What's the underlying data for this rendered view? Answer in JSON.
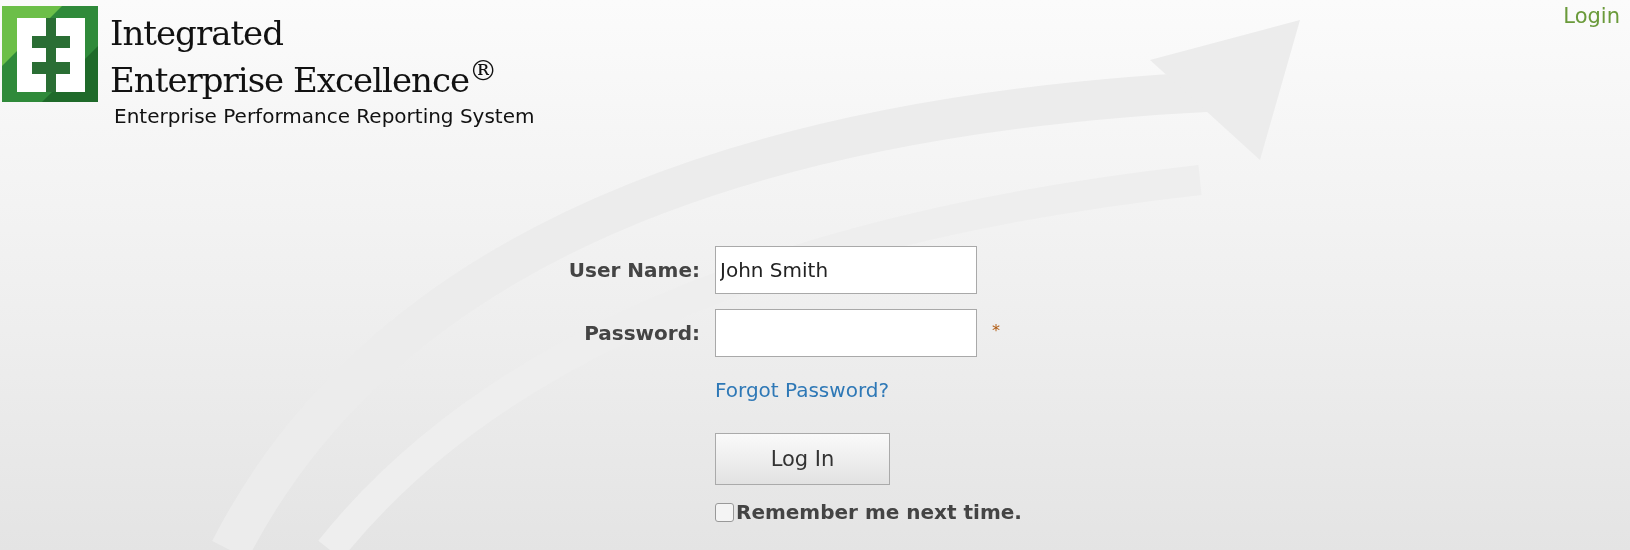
{
  "header": {
    "title_line_1": "Integrated",
    "title_line_2": "Enterprise Excellence",
    "title_mark": "®",
    "subtitle": "Enterprise Performance Reporting System",
    "login_link": "Login"
  },
  "form": {
    "fields": [
      {
        "label": "User Name:",
        "value": "John Smith"
      },
      {
        "label": "Password:",
        "required_mark": "*"
      }
    ],
    "forgot_link": "Forgot Password?",
    "submit": "Log In",
    "remember": {
      "label": "Remember me next time.",
      "checked": false
    }
  }
}
